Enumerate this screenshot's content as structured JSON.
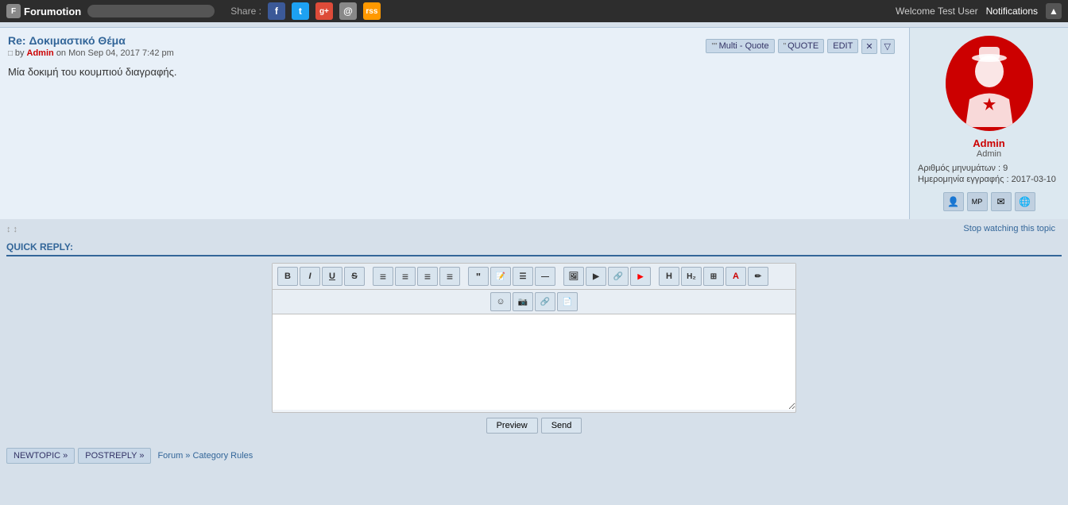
{
  "topbar": {
    "logo": "Forumotion",
    "search_placeholder": "",
    "share_label": "Share :",
    "welcome_text": "Welcome Test User",
    "notifications_label": "Notifications"
  },
  "social": {
    "facebook": "f",
    "twitter": "t",
    "googleplus": "g+",
    "email": "@",
    "rss": "rss"
  },
  "post": {
    "title": "Re: Δοκιμαστικό Θέμα",
    "meta": "by Admin on Mon Sep 04, 2017 7:42 pm",
    "body": "Μία δοκιμή του κουμπιού διαγραφής.",
    "multi_quote_label": "Multi - Quote",
    "quote_label": "QUOTE",
    "edit_label": "EDIT"
  },
  "sidebar": {
    "username": "Admin",
    "role": "Admin",
    "messages_label": "Αριθμός μηνυμάτων :",
    "messages_count": "9",
    "join_label": "Ημερομηνία εγγραφής :",
    "join_date": "2017-03-10"
  },
  "post_footer": {
    "arrows": "↕↕",
    "watch_label": "Stop watching this topic"
  },
  "quick_reply": {
    "label": "QUICK REPLY:",
    "preview_btn": "Preview",
    "send_btn": "Send"
  },
  "toolbar": {
    "bold": "B",
    "italic": "I",
    "underline": "U",
    "strike": "S",
    "align_left": "≡",
    "align_center": "≡",
    "align_right": "≡",
    "justify": "≡",
    "emoji": "☺",
    "h_btn": "H",
    "color": "A"
  },
  "bottom_nav": {
    "newtopic": "NEWTOPIC »",
    "postreply": "POSTREPLY »",
    "forum_link": "Forum » Category Rules"
  }
}
